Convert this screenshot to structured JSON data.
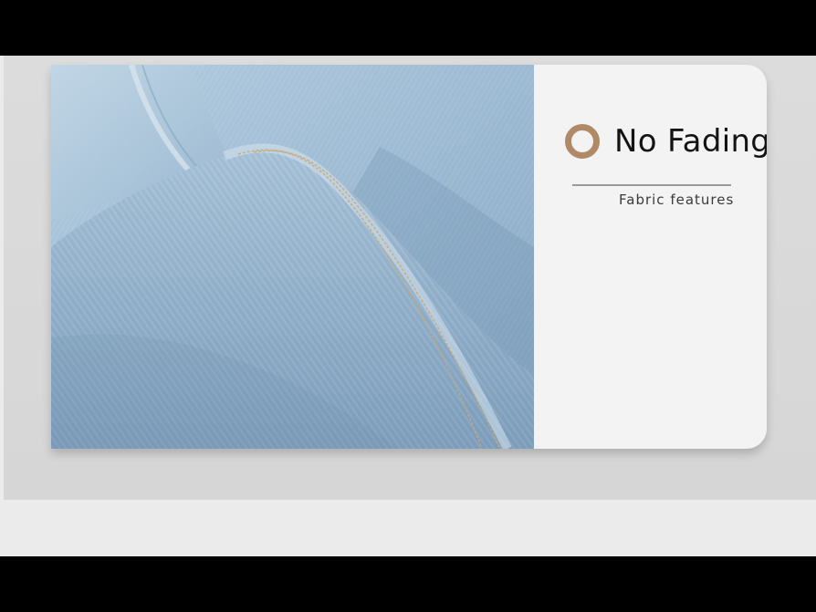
{
  "feature": {
    "title": "No Fading",
    "subtitle": "Fabric features",
    "icon": "ring-icon",
    "accent_color": "#b08a66"
  },
  "photo": {
    "subject": "denim-fabric-photo",
    "tint": "#8eaecb"
  }
}
